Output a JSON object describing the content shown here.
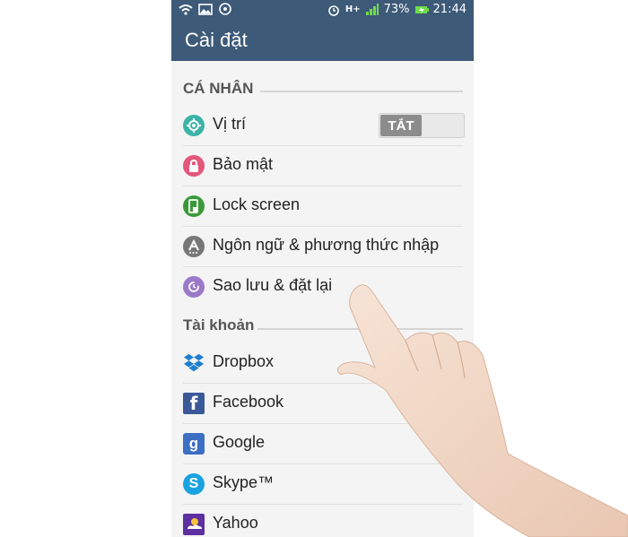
{
  "statusbar": {
    "battery": "73%",
    "time": "21:44",
    "signal": "H+",
    "left_icons": [
      "wifi-icon",
      "image-icon",
      "notification-icon"
    ],
    "right_icons": [
      "alarm-icon",
      "signal-icon",
      "battery-charging-icon"
    ]
  },
  "appbar": {
    "title": "Cài đặt"
  },
  "sections": {
    "personal": "CÁ NHÂN",
    "accounts": "Tài khoản"
  },
  "location_toggle": {
    "state_label": "TẮT"
  },
  "personal_items": [
    {
      "label": "Vị trí",
      "icon": "location-icon",
      "color": "#3bb3a8"
    },
    {
      "label": "Bảo mật",
      "icon": "lock-icon",
      "color": "#e2577a"
    },
    {
      "label": "Lock screen",
      "icon": "lock-screen-icon",
      "color": "#3a9a3a"
    },
    {
      "label": "Ngôn ngữ & phương thức nhập",
      "icon": "language-icon",
      "color": "#777777"
    },
    {
      "label": "Sao lưu & đặt lại",
      "icon": "backup-icon",
      "color": "#9b7ac9"
    }
  ],
  "account_items": [
    {
      "label": "Dropbox",
      "icon": "dropbox-icon",
      "color": "#1e7ecf"
    },
    {
      "label": "Facebook",
      "icon": "facebook-icon",
      "color": "#3b5998"
    },
    {
      "label": "Google",
      "icon": "google-icon",
      "color": "#3c6fc4"
    },
    {
      "label": "Skype™",
      "icon": "skype-icon",
      "color": "#1aa3e0"
    },
    {
      "label": "Yahoo",
      "icon": "yahoo-icon",
      "color": "#5d2fa0"
    }
  ],
  "colors": {
    "header": "#3d5a78",
    "background": "#f4f4f4"
  }
}
